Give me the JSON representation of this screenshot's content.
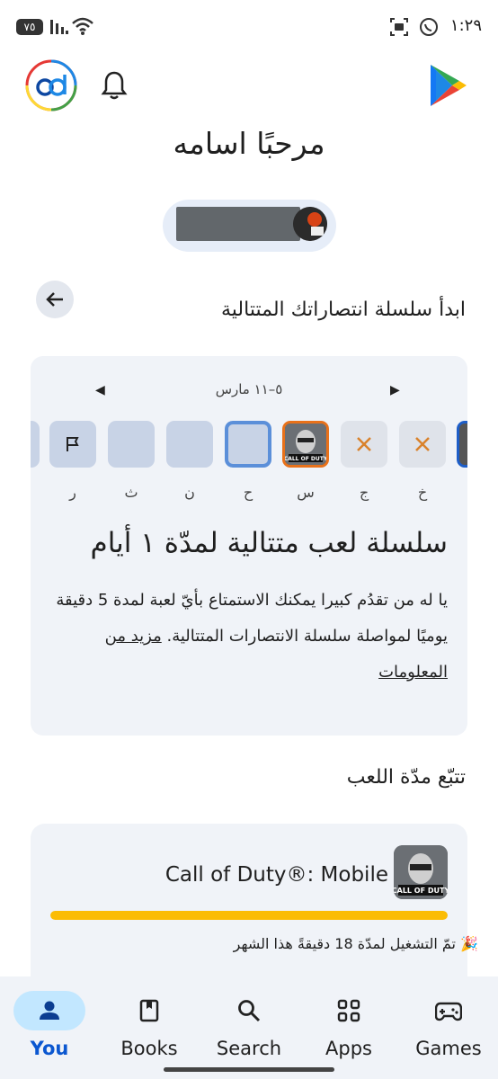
{
  "status_bar": {
    "time": "١:٢٩",
    "battery": "٧٥"
  },
  "greeting": "مرحبًا اسامه",
  "streak_section": {
    "title": "ابدأ سلسلة انتصاراتك المتتالية",
    "week_range": "٥–١١ مارس",
    "days": [
      {
        "label": "خ",
        "state": "missed"
      },
      {
        "label": "ج",
        "state": "missed"
      },
      {
        "label": "س",
        "state": "played"
      },
      {
        "label": "ح",
        "state": "today"
      },
      {
        "label": "ن",
        "state": "empty"
      },
      {
        "label": "ث",
        "state": "empty"
      },
      {
        "label": "ر",
        "state": "goal"
      }
    ],
    "heading": "سلسلة لعب متتالية لمدّة ١ أيام",
    "body": "يا له من تقدُم كبيرا يمكنك الاستمتاع بأيّ لعبة لمدة 5 دقيقة يوميًا لمواصلة سلسلة الانتصارات المتتالية.",
    "learn_more": "مزيد من المعلومات"
  },
  "playtime_section": {
    "title": "تتبّع مدّة اللعب",
    "game": {
      "name": "Call of Duty®: Mobile",
      "icon_caption": "CALL OF DUTY",
      "progress": 1.0,
      "played_text": "تمّ التشغيل لمدّة 18 دقيقةً هذا الشهر"
    }
  },
  "bottom_nav": {
    "items": [
      {
        "label": "You",
        "icon": "person-icon",
        "active": true
      },
      {
        "label": "Books",
        "icon": "book-icon",
        "active": false
      },
      {
        "label": "Search",
        "icon": "search-icon",
        "active": false
      },
      {
        "label": "Apps",
        "icon": "apps-grid-icon",
        "active": false
      },
      {
        "label": "Games",
        "icon": "gamepad-icon",
        "active": false
      }
    ]
  },
  "colors": {
    "accent": "#0b57d0",
    "nav_active_bg": "#c2e7ff",
    "card_bg": "#f0f3f8",
    "progress": "#fbbc04",
    "missed_x": "#d9822b",
    "today_border": "#5b8fd9",
    "played_border": "#e8711a"
  }
}
